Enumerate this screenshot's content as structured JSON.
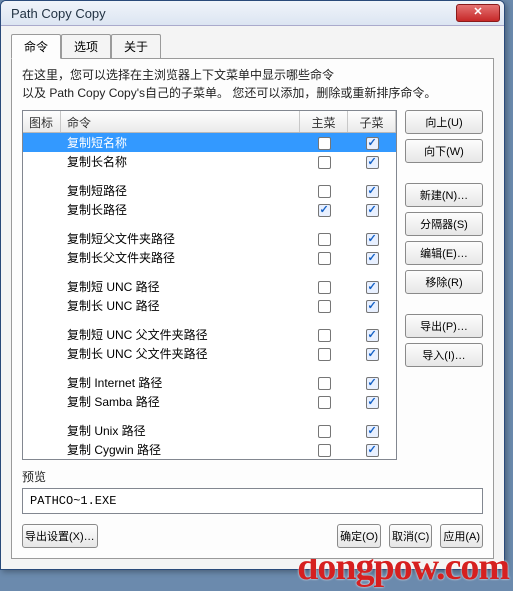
{
  "window": {
    "title": "Path Copy Copy"
  },
  "tabs": [
    {
      "label": "命令",
      "active": true
    },
    {
      "label": "选项",
      "active": false
    },
    {
      "label": "关于",
      "active": false
    }
  ],
  "desc_line1": "在这里，您可以选择在主浏览器上下文菜单中显示哪些命令",
  "desc_line2": "以及 Path Copy Copy's自己的子菜单。 您还可以添加，删除或重新排序命令。",
  "columns": {
    "icon": "图标",
    "cmd": "命令",
    "main": "主菜单",
    "sub": "子菜单"
  },
  "rows": [
    {
      "label": "复制短名称",
      "main": false,
      "sub": true,
      "selected": true
    },
    {
      "label": "复制长名称",
      "main": false,
      "sub": true
    },
    {
      "sep": true
    },
    {
      "label": "复制短路径",
      "main": false,
      "sub": true
    },
    {
      "label": "复制长路径",
      "main": true,
      "sub": true
    },
    {
      "sep": true
    },
    {
      "label": "复制短父文件夹路径",
      "main": false,
      "sub": true
    },
    {
      "label": "复制长父文件夹路径",
      "main": false,
      "sub": true
    },
    {
      "sep": true
    },
    {
      "label": "复制短 UNC 路径",
      "main": false,
      "sub": true
    },
    {
      "label": "复制长 UNC 路径",
      "main": false,
      "sub": true
    },
    {
      "sep": true
    },
    {
      "label": "复制短 UNC 父文件夹路径",
      "main": false,
      "sub": true
    },
    {
      "label": "复制长 UNC 父文件夹路径",
      "main": false,
      "sub": true
    },
    {
      "sep": true
    },
    {
      "label": "复制 Internet 路径",
      "main": false,
      "sub": true
    },
    {
      "label": "复制 Samba 路径",
      "main": false,
      "sub": true
    },
    {
      "sep": true
    },
    {
      "label": "复制 Unix 路径",
      "main": false,
      "sub": true
    },
    {
      "label": "复制 Cygwin 路径",
      "main": false,
      "sub": true
    }
  ],
  "side_buttons": {
    "up": "向上(U)",
    "down": "向下(W)",
    "new": "新建(N)…",
    "separator": "分隔器(S)",
    "edit": "编辑(E)…",
    "remove": "移除(R)",
    "export": "导出(P)…",
    "import": "导入(I)…"
  },
  "preview": {
    "label": "预览",
    "value": "PATHCO~1.EXE"
  },
  "footer": {
    "export_settings": "导出设置(X)…",
    "ok": "确定(O)",
    "cancel": "取消(C)",
    "apply": "应用(A)"
  },
  "watermark": "dongpow.com"
}
